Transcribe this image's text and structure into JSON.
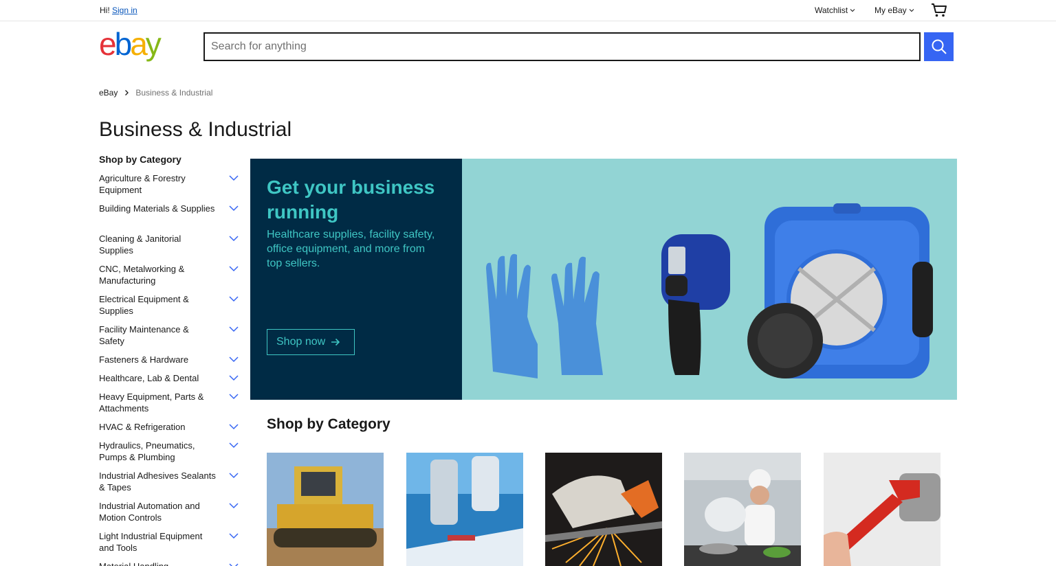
{
  "topbar": {
    "greeting": "Hi!",
    "sign_in": "Sign in",
    "watchlist": "Watchlist",
    "my_ebay": "My eBay"
  },
  "header": {
    "logo_text": "ebay",
    "search_placeholder": "Search for anything"
  },
  "breadcrumb": {
    "home": "eBay",
    "current": "Business & Industrial"
  },
  "page": {
    "title": "Business & Industrial"
  },
  "sidebar": {
    "heading": "Shop by Category",
    "items": [
      {
        "label": "Agriculture & Forestry Equipment"
      },
      {
        "label": "Building Materials & Supplies"
      },
      {
        "label": "Cleaning & Janitorial Supplies"
      },
      {
        "label": "CNC, Metalworking & Manufacturing"
      },
      {
        "label": "Electrical Equipment & Supplies"
      },
      {
        "label": "Facility Maintenance & Safety"
      },
      {
        "label": "Fasteners & Hardware"
      },
      {
        "label": "Healthcare, Lab & Dental"
      },
      {
        "label": "Heavy Equipment, Parts & Attachments"
      },
      {
        "label": "HVAC & Refrigeration"
      },
      {
        "label": "Hydraulics, Pneumatics, Pumps & Plumbing"
      },
      {
        "label": "Industrial Adhesives Sealants & Tapes"
      },
      {
        "label": "Industrial Automation and Motion Controls"
      },
      {
        "label": "Light Industrial Equipment and Tools"
      },
      {
        "label": "Material Handling"
      }
    ]
  },
  "hero": {
    "title": "Get your business running",
    "subtitle": "Healthcare supplies, facility safety, office equipment, and more from top sellers.",
    "button": "Shop now"
  },
  "category_section": {
    "title": "Shop by Category",
    "tiles": [
      "bulldozer-image",
      "microscope-image",
      "metal-cutting-image",
      "chef-kitchen-image",
      "pipe-wrench-image"
    ]
  },
  "colors": {
    "accent": "#3665f3",
    "hero_dark": "#002b45",
    "hero_teal": "#92d4d4",
    "hero_text": "#3fc6c4",
    "link": "#0654ba"
  }
}
